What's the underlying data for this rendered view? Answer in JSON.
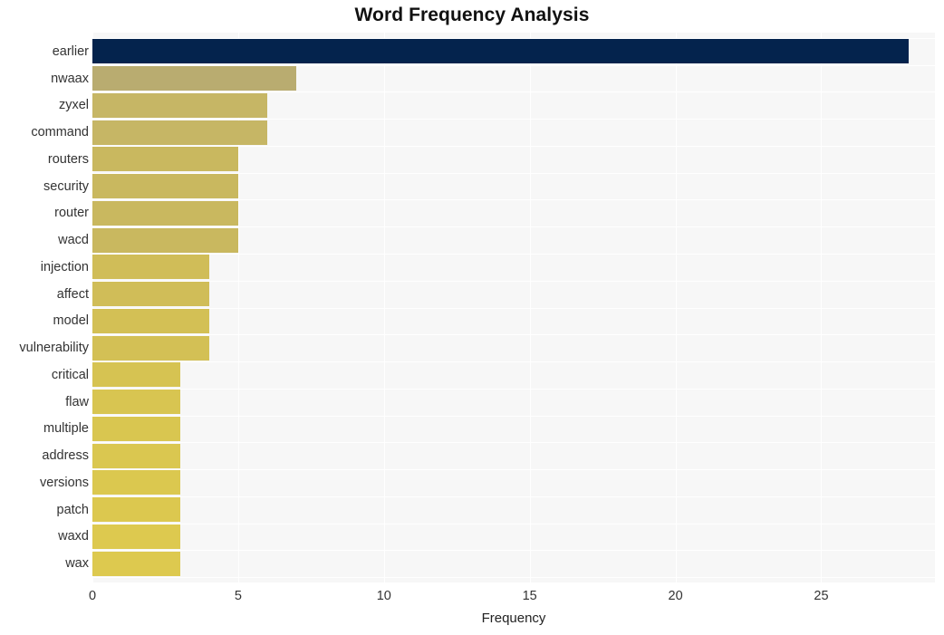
{
  "chart_data": {
    "type": "bar",
    "orientation": "horizontal",
    "title": "Word Frequency Analysis",
    "xlabel": "Frequency",
    "ylabel": "",
    "categories": [
      "earlier",
      "nwaax",
      "zyxel",
      "command",
      "routers",
      "security",
      "router",
      "wacd",
      "injection",
      "affect",
      "model",
      "vulnerability",
      "critical",
      "flaw",
      "multiple",
      "address",
      "versions",
      "patch",
      "waxd",
      "wax"
    ],
    "values": [
      28,
      7,
      6,
      6,
      5,
      5,
      5,
      5,
      4,
      4,
      4,
      4,
      3,
      3,
      3,
      3,
      3,
      3,
      3,
      3
    ],
    "xlim": [
      0,
      28.9
    ],
    "xticks": [
      0,
      5,
      10,
      15,
      20,
      25
    ],
    "xtick_labels": [
      "0",
      "5",
      "10",
      "15",
      "20",
      "25"
    ],
    "grid": true,
    "grid_color": "#ffffff",
    "plot_background": "#f7f7f7",
    "figure_background": "#ffffff",
    "legend": false,
    "bar_colors": [
      "#04234d",
      "#b9ac70",
      "#c6b665",
      "#c6b665",
      "#c9b85f",
      "#c9b85f",
      "#c9b85f",
      "#c9b85f",
      "#d0bd58",
      "#d0bd58",
      "#d3c055",
      "#d3c055",
      "#d6c352",
      "#d8c551",
      "#d9c650",
      "#dac750",
      "#dbc84f",
      "#dcc84f",
      "#ddc94f",
      "#ddc94f"
    ]
  }
}
